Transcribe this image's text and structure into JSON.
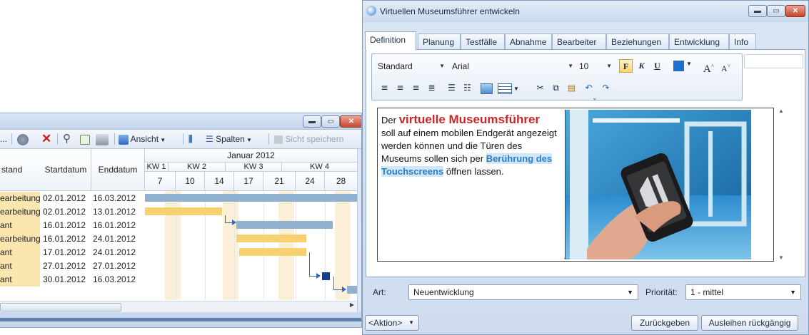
{
  "back_window": {
    "toolbar": {
      "ellipsis": "...",
      "view_label": "Ansicht",
      "columns_label": "Spalten",
      "save_view_label": "Sicht speichern"
    },
    "columns": {
      "status": "stand",
      "start": "Startdatum",
      "end": "Enddatum",
      "month": "Januar 2012",
      "weeks": [
        "KW 1",
        "KW 2",
        "KW 3",
        "KW 4"
      ],
      "days": [
        "7",
        "10",
        "14",
        "17",
        "21",
        "24",
        "28"
      ]
    },
    "rows": [
      {
        "status": "earbeitung",
        "start": "02.01.2012",
        "end": "16.03.2012"
      },
      {
        "status": "earbeitung",
        "start": "02.01.2012",
        "end": "13.01.2012"
      },
      {
        "status": "ant",
        "start": "16.01.2012",
        "end": "16.01.2012"
      },
      {
        "status": "earbeitung",
        "start": "16.01.2012",
        "end": "24.01.2012"
      },
      {
        "status": "ant",
        "start": "17.01.2012",
        "end": "24.01.2012"
      },
      {
        "status": "ant",
        "start": "27.01.2012",
        "end": "27.01.2012"
      },
      {
        "status": "ant",
        "start": "30.01.2012",
        "end": "16.03.2012"
      }
    ]
  },
  "dialog": {
    "title": "Virtuellen Museumsführer entwickeln",
    "tabs": [
      {
        "label": "Definition"
      },
      {
        "label": "Planung"
      },
      {
        "label": "Testfälle"
      },
      {
        "label": "Abnahme"
      },
      {
        "label": "Bearbeiter"
      },
      {
        "label": "Beziehungen"
      },
      {
        "label": "Entwicklung"
      },
      {
        "label": "Info"
      }
    ],
    "format": {
      "style": "Standard",
      "font": "Arial",
      "size": "10",
      "bold": "F",
      "italic": "K",
      "underline": "U",
      "grow": "A",
      "shrink": "A",
      "text_color": "#1f6fd1"
    },
    "content": {
      "prefix": "Der",
      "headline": "virtuelle Museumsführer",
      "body": "soll auf einem mobilen Endgerät angezeigt werden können und die Türen des Museums sollen sich per",
      "highlight": "Berührung des Touchscreens",
      "suffix": "öffnen lassen."
    },
    "art_label": "Art:",
    "art_value": "Neuentwicklung",
    "priority_label": "Priorität:",
    "priority_value": "1 - mittel",
    "action_label": "<Aktion>",
    "return_label": "Zurückgeben",
    "undo_borrow_label": "Ausleihen rückgängig"
  }
}
